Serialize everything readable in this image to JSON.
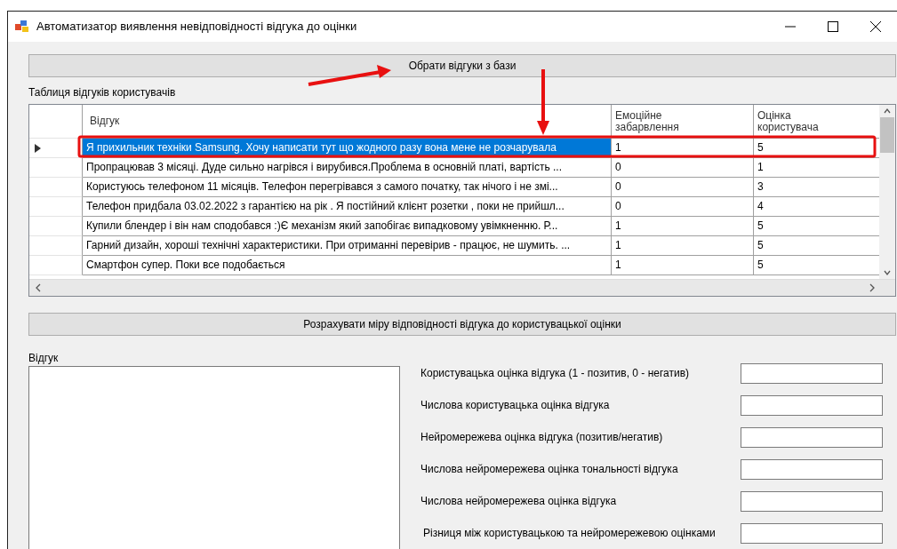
{
  "window": {
    "title": "Автоматизатор виявлення невідповідності відгука до оцінки"
  },
  "load_button": {
    "label": "Обрати відгуки з бази"
  },
  "table_label": "Таблиця відгуків користувачів",
  "table": {
    "columns": [
      "Відгук",
      "Емоційне забарвлення",
      "Оцінка користувача"
    ],
    "rows": [
      {
        "cells": [
          "Я прихильник техніки Samsung. Хочу написати тут що жодного разу вона мене не розчарувала",
          "1",
          "5"
        ],
        "selected": true
      },
      {
        "cells": [
          "Пропрацював 3 місяці. Дуде сильно нагрівся і вирубився.Проблема в основній платі, вартість ...",
          "0",
          "1"
        ],
        "selected": false
      },
      {
        "cells": [
          "Користуюсь телефоном 11 місяців. Телефон перегрівався з самого початку, так нічого і не змі...",
          "0",
          "3"
        ],
        "selected": false
      },
      {
        "cells": [
          "Телефон придбала 03.02.2022 з гарантією на рік . Я постійний клієнт розетки , поки не прийшл...",
          "0",
          "4"
        ],
        "selected": false
      },
      {
        "cells": [
          "Купили блендер і він нам сподобався :)Є механізм який запобігає випадковому увімкненню. Р...",
          "1",
          "5"
        ],
        "selected": false
      },
      {
        "cells": [
          "Гарний дизайн, хороші технічні характеристики. При отриманні перевірив - працює, не шумить. ...",
          "1",
          "5"
        ],
        "selected": false
      },
      {
        "cells": [
          "Смартфон супер. Поки все подобається",
          "1",
          "5"
        ],
        "selected": false
      }
    ]
  },
  "calc_button": {
    "label": "Розрахувати міру відповідності відгука до користувацької оцінки"
  },
  "review_label": "Відгук",
  "fields": [
    {
      "label": "Користувацька оцінка відгука (1 - позитив, 0 - негатив)"
    },
    {
      "label": "Числова користувацька оцінка відгука"
    },
    {
      "label": "Нейромережева оцінка відгука (позитив/негатив)"
    },
    {
      "label": "Числова нейромережева оцінка тональності відгука"
    },
    {
      "label": "Числова нейромережева оцінка відгука"
    },
    {
      "label": "Різниця між користувацькою та нейромережевою оцінками"
    }
  ]
}
